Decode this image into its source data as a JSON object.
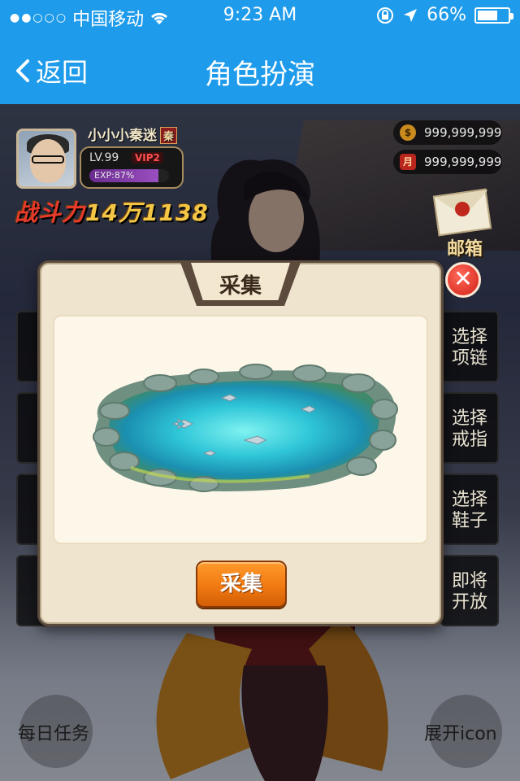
{
  "status_bar": {
    "signal_dots": "●●○○○",
    "carrier": "中国移动",
    "time": "9:23 AM",
    "battery": "66%",
    "battery_level": 0.66
  },
  "nav": {
    "back_label": "返回",
    "title": "角色扮演"
  },
  "player": {
    "name": "小小小秦迷",
    "faction_badge": "秦",
    "level": "LV.99",
    "vip": "VIP2",
    "exp": "EXP:87%",
    "exp_fraction": 0.87,
    "power_prefix": "战斗力",
    "power_value": "14万1138"
  },
  "currency": {
    "gold": "999,999,999",
    "gold_icon": "$",
    "ingot": "999,999,999",
    "ingot_icon": "月"
  },
  "mail": {
    "label": "邮箱"
  },
  "right_menu": [
    {
      "line1": "选择",
      "line2": "项链"
    },
    {
      "line1": "选择",
      "line2": "戒指"
    },
    {
      "line1": "选择",
      "line2": "鞋子"
    },
    {
      "line1": "即将",
      "line2": "开放"
    }
  ],
  "bottom": {
    "daily_tasks": "每日任务",
    "expand": "展开icon"
  },
  "modal": {
    "title": "采集",
    "collect_button": "采集",
    "close_glyph": "✕"
  },
  "colors": {
    "nav_blue": "#1e9bea",
    "collect_orange": "#f07a12",
    "close_red": "#d11f16"
  }
}
